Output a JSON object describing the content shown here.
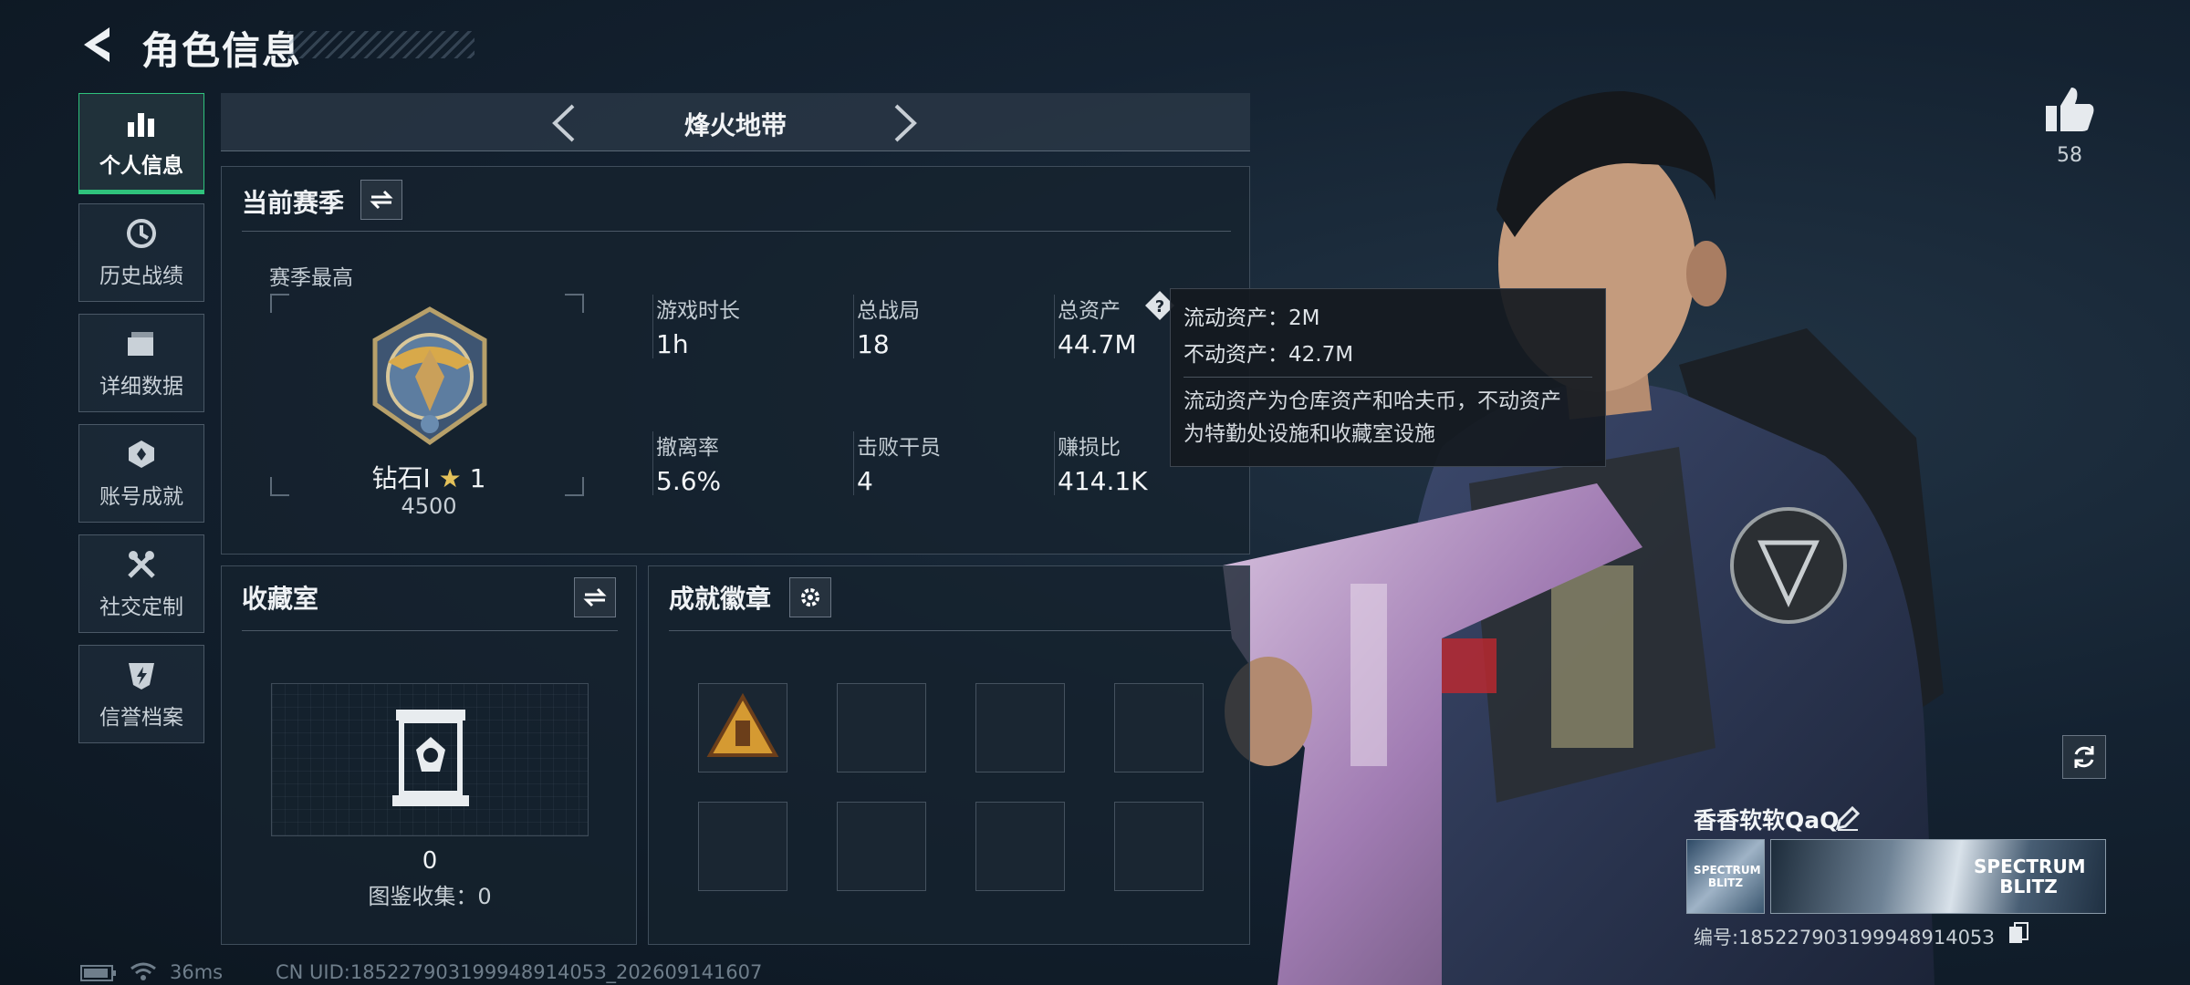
{
  "header": {
    "title": "角色信息"
  },
  "sidebar": {
    "items": [
      {
        "label": "个人信息",
        "icon": "bar-chart-icon",
        "active": true
      },
      {
        "label": "历史战绩",
        "icon": "history-icon"
      },
      {
        "label": "详细数据",
        "icon": "folder-icon"
      },
      {
        "label": "账号成就",
        "icon": "achievement-icon"
      },
      {
        "label": "社交定制",
        "icon": "tools-icon"
      },
      {
        "label": "信誉档案",
        "icon": "shield-lightning-icon"
      }
    ]
  },
  "mode": {
    "title": "烽火地带"
  },
  "season": {
    "title": "当前赛季",
    "best_label": "赛季最高",
    "rank_name": "钻石Ⅰ",
    "rank_stars": "1",
    "rank_score": "4500",
    "stats": [
      {
        "label": "游戏时长",
        "value": "1h"
      },
      {
        "label": "总战局",
        "value": "18"
      },
      {
        "label": "总资产",
        "value": "44.7M"
      },
      {
        "label": "撤离率",
        "value": "5.6%"
      },
      {
        "label": "击败干员",
        "value": "4"
      },
      {
        "label": "赚损比",
        "value": "414.1K"
      }
    ]
  },
  "tooltip": {
    "line1": "流动资产：2M",
    "line2": "不动资产：42.7M",
    "desc1": "流动资产为仓库资产和哈夫币，不动资产",
    "desc2": "为特勤处设施和收藏室设施"
  },
  "collection": {
    "title": "收藏室",
    "count": "0",
    "dex_label": "图鉴收集：0"
  },
  "badges": {
    "title": "成就徽章"
  },
  "likes": {
    "count": "58"
  },
  "profile": {
    "name": "香香软软QaQ",
    "id_label": "编号:18522790319994891405З",
    "card_text_small": "SPECTRUM BLITZ",
    "card_text_large": "SPECTRUM BLITZ"
  },
  "status": {
    "ping": "36ms",
    "uid": "CN UID:18522790319994891405З_202609141607"
  },
  "colors": {
    "accent": "#2fc27c",
    "panel": "#16222e",
    "tooltip_bg": "#14191f"
  }
}
